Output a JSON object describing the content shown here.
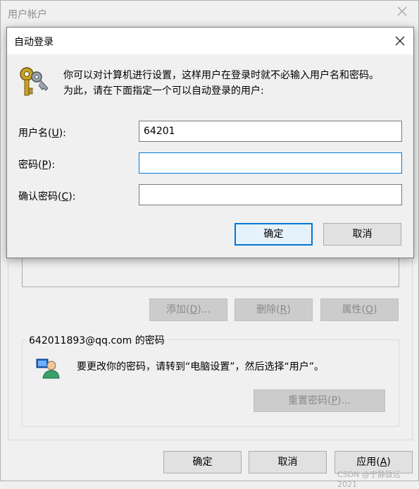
{
  "bg_window": {
    "title": "用户帐户",
    "buttons": {
      "add": "添加(D)...",
      "remove": "删除(R)",
      "properties": "属性(O)"
    },
    "group": {
      "label": "642011893@qq.com 的密码",
      "description": "要更改你的密码，请转到“电脑设置”，然后选择“用户”。",
      "reset_button": "重置密码(P)..."
    },
    "footer": {
      "ok": "确定",
      "cancel": "取消",
      "apply": "应用(A)"
    }
  },
  "dialog": {
    "title": "自动登录",
    "line1": "你可以对计算机进行设置，这样用户在登录时就不必输入用户名和密码。",
    "line2": "为此，请在下面指定一个可以自动登录的用户:",
    "fields": [
      {
        "label": "用户名(U):",
        "value": ""
      },
      {
        "label": "密码(P):",
        "value": ""
      },
      {
        "label": "确认密码(C):",
        "value": ""
      }
    ],
    "username_value": "64201",
    "ok": "确定",
    "cancel": "取消"
  },
  "watermark": "CSDN @宁静致远2021",
  "icons": {
    "keys": "keys-icon",
    "user": "user-icon",
    "close": "close-icon"
  }
}
